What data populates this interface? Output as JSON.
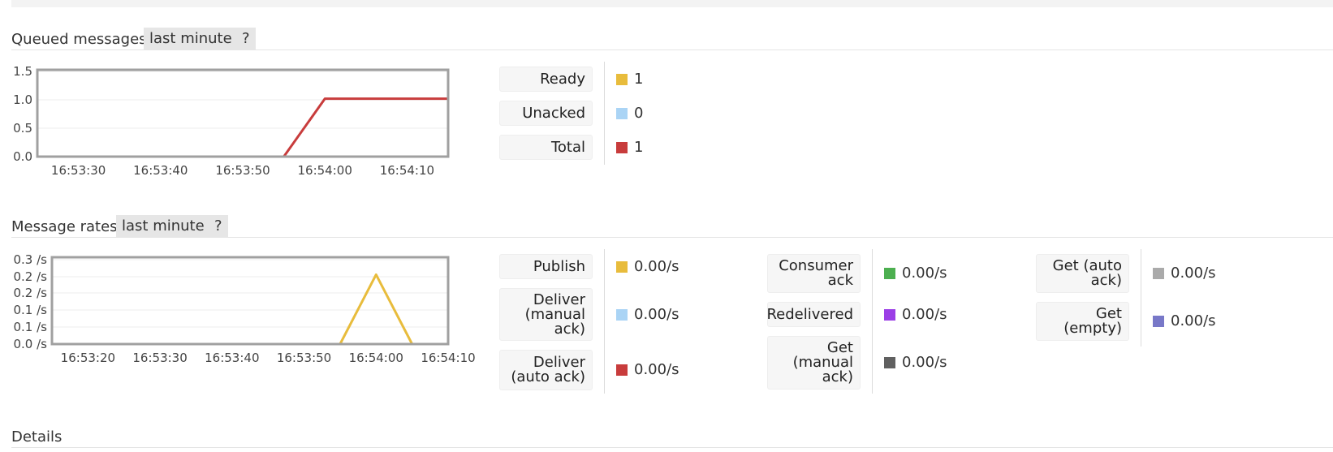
{
  "queued": {
    "title": "Queued messages",
    "range_label": "last minute",
    "help_label": "?",
    "chart_data": {
      "type": "line",
      "x": [
        "16:53:25",
        "16:53:30",
        "16:53:35",
        "16:53:40",
        "16:53:45",
        "16:53:50",
        "16:53:55",
        "16:54:00",
        "16:54:05",
        "16:54:10",
        "16:54:15"
      ],
      "x_ticks": [
        "16:53:30",
        "16:53:40",
        "16:53:50",
        "16:54:00",
        "16:54:10"
      ],
      "y_ticks": [
        "0.0",
        "0.5",
        "1.0",
        "1.5"
      ],
      "ylim": [
        0,
        1.5
      ],
      "series": [
        {
          "name": "Unacked",
          "color": "#aad4f5",
          "values": [
            0,
            0,
            0,
            0,
            0,
            0,
            0,
            0,
            0,
            0,
            0
          ]
        },
        {
          "name": "Total",
          "color": "#c83c3c",
          "values": [
            0,
            0,
            0,
            0,
            0,
            0,
            0,
            1,
            1,
            1,
            1
          ]
        }
      ]
    },
    "legend": [
      {
        "label": "Ready",
        "color": "#e8bc3c",
        "value": "1"
      },
      {
        "label": "Unacked",
        "color": "#aad4f5",
        "value": "0"
      },
      {
        "label": "Total",
        "color": "#c83c3c",
        "value": "1"
      }
    ]
  },
  "rates": {
    "title": "Message rates",
    "range_label": "last minute",
    "help_label": "?",
    "chart_data": {
      "type": "line",
      "x": [
        "16:53:15",
        "16:53:20",
        "16:53:25",
        "16:53:30",
        "16:53:35",
        "16:53:40",
        "16:53:45",
        "16:53:50",
        "16:53:55",
        "16:54:00",
        "16:54:05",
        "16:54:10"
      ],
      "x_ticks": [
        "16:53:20",
        "16:53:30",
        "16:53:40",
        "16:53:50",
        "16:54:00",
        "16:54:10"
      ],
      "y_ticks": [
        "0.0 /s",
        "0.1 /s",
        "0.1 /s",
        "0.2 /s",
        "0.2 /s",
        "0.3 /s"
      ],
      "ylim": [
        0,
        0.25
      ],
      "series": [
        {
          "name": "Publish",
          "color": "#e8bc3c",
          "values": [
            0,
            0,
            0,
            0,
            0,
            0,
            0,
            0,
            0,
            0.2,
            0,
            0
          ]
        },
        {
          "name": "Get (empty)",
          "color": "#7878c8",
          "values": [
            0,
            0,
            0,
            0,
            0,
            0,
            0,
            0,
            0,
            0,
            0,
            0
          ]
        }
      ]
    },
    "legend_col1": [
      {
        "lines": [
          "Publish"
        ],
        "color": "#e8bc3c",
        "value": "0.00/s"
      },
      {
        "lines": [
          "Deliver",
          "(manual",
          "ack)"
        ],
        "color": "#aad4f5",
        "value": "0.00/s"
      },
      {
        "lines": [
          "Deliver",
          "(auto ack)"
        ],
        "color": "#c83c3c",
        "value": "0.00/s"
      }
    ],
    "legend_col2": [
      {
        "lines": [
          "Consumer",
          "ack"
        ],
        "color": "#4caf50",
        "value": "0.00/s"
      },
      {
        "lines": [
          "Redelivered"
        ],
        "color": "#9b3ee6",
        "value": "0.00/s"
      },
      {
        "lines": [
          "Get",
          "(manual",
          "ack)"
        ],
        "color": "#606060",
        "value": "0.00/s"
      }
    ],
    "legend_col3": [
      {
        "lines": [
          "Get (auto",
          "ack)"
        ],
        "color": "#aaaaaa",
        "value": "0.00/s"
      },
      {
        "lines": [
          "Get",
          "(empty)"
        ],
        "color": "#7878c8",
        "value": "0.00/s"
      }
    ]
  },
  "details": {
    "title": "Details"
  }
}
